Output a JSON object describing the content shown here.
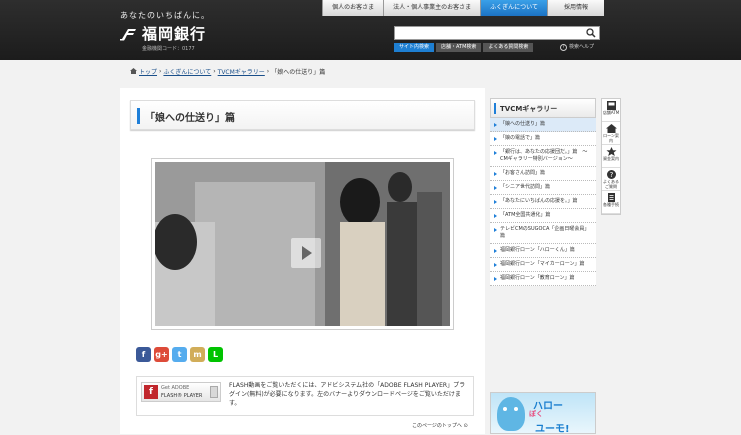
{
  "header": {
    "tagline": "あなたのいちばんに。",
    "bank_name": "福岡銀行",
    "bank_code": "金融機関コード：0177",
    "nav": [
      "個人のお客さま",
      "法人・個人事業主のお客さま",
      "ふくぎんについて",
      "採用情報"
    ],
    "search_placeholder": "",
    "search_tabs": [
      "サイト内検索",
      "店舗・ATM検索",
      "よくある質問検索"
    ],
    "help": "検索ヘルプ"
  },
  "breadcrumb": {
    "home": "トップ",
    "items": [
      "ふくぎんについて",
      "TVCMギャラリー"
    ],
    "current": "「娘への仕送り」篇"
  },
  "main": {
    "title": "「娘への仕送り」篇",
    "flash": {
      "badge_get": "Get ADOBE",
      "badge_product": "FLASH® PLAYER",
      "text": "FLASH動画をご覧いただくには、アドビシステム社の「ADOBE FLASH PLAYER」プラグイン(無料)が必要になります。左のバナーよりダウンロードページをご覧いただけます。"
    },
    "page_top": "このページのトップへ"
  },
  "social": [
    {
      "name": "facebook",
      "glyph": "f",
      "color": "#3b5998"
    },
    {
      "name": "google-plus",
      "glyph": "g+",
      "color": "#dd4b39"
    },
    {
      "name": "twitter",
      "glyph": "t",
      "color": "#55acee"
    },
    {
      "name": "mixi",
      "glyph": "m",
      "color": "#d1ad59"
    },
    {
      "name": "line",
      "glyph": "L",
      "color": "#00c300"
    }
  ],
  "sidebar": {
    "title": "TVCMギャラリー",
    "items": [
      "「娘への仕送り」篇",
      "「娘の電話で」篇",
      "「銀行は、あなたの応援団だ。」篇　〜CMギャラリー特別バージョン〜",
      "「お客さん訪問」篇",
      "「シニア世代訪問」篇",
      "「あなたにいちばんの応援を。」篇",
      "「ATM全国共通化」篇",
      "テレビCMのSUGOCA「企画日曜会員」篇",
      "福岡銀行ローン「ハローくん」篇",
      "福岡銀行ローン「マイカーローン」篇",
      "福岡銀行ローン「教育ローン」篇"
    ]
  },
  "banner": {
    "line1": "ハロー",
    "line2": "ぼく",
    "line3": "ユーモ!"
  },
  "quickmenu": [
    {
      "label": "店舗ATM",
      "icon": "atm-icon"
    },
    {
      "label": "ローン案内",
      "icon": "home-icon"
    },
    {
      "label": "資金案内",
      "icon": "star-icon"
    },
    {
      "label": "よくあるご質問",
      "icon": "question-icon"
    },
    {
      "label": "各種手続",
      "icon": "document-icon"
    }
  ]
}
